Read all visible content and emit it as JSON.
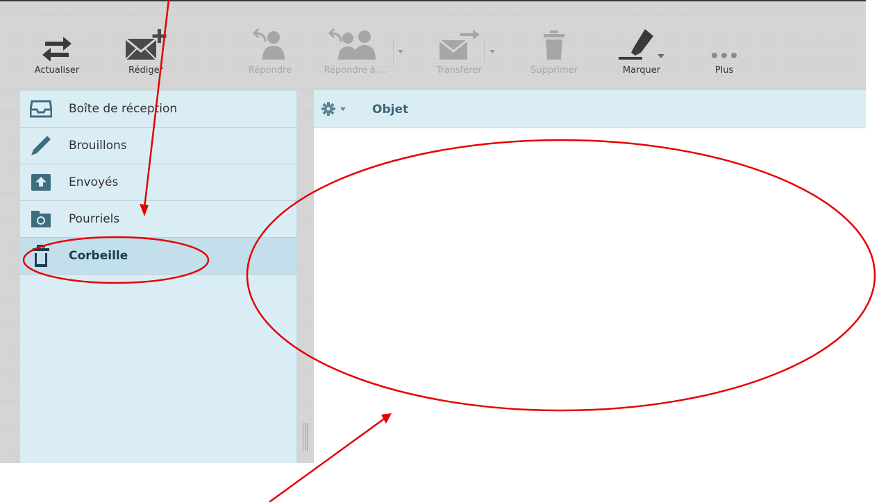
{
  "toolbar": {
    "refresh_label": "Actualiser",
    "compose_label": "Rédiger",
    "reply_label": "Répondre",
    "reply_all_label": "Répondre à ...",
    "forward_label": "Transférer",
    "delete_label": "Supprimer",
    "mark_label": "Marquer",
    "more_label": "Plus"
  },
  "folders": {
    "items": [
      {
        "label": "Boîte de réception",
        "icon": "inbox-icon"
      },
      {
        "label": "Brouillons",
        "icon": "pencil-icon"
      },
      {
        "label": "Envoyés",
        "icon": "sent-icon"
      },
      {
        "label": "Pourriels",
        "icon": "spam-icon"
      },
      {
        "label": "Corbeille",
        "icon": "trash-icon",
        "selected": true
      }
    ]
  },
  "message_list": {
    "column_subject": "Objet"
  },
  "colors": {
    "panel_bg": "#daedf4",
    "selected_bg": "#c2dfeb",
    "annotation": "#e60000",
    "disabled_text": "#a8a8a8"
  }
}
